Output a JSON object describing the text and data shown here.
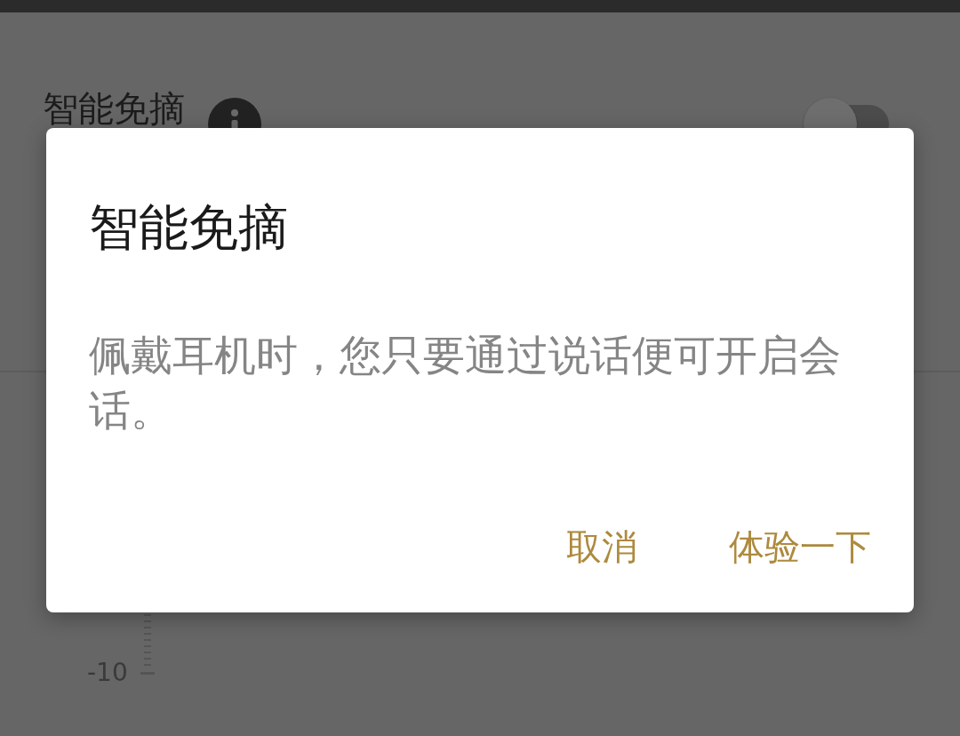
{
  "background": {
    "setting": {
      "label": "智能免摘",
      "on": false
    },
    "chart_axis": {
      "tick_label": "-10"
    }
  },
  "dialog": {
    "title": "智能免摘",
    "message": "佩戴耳机时，您只要通过说话便可开启会话。",
    "buttons": [
      "取消",
      "体验一下"
    ]
  }
}
